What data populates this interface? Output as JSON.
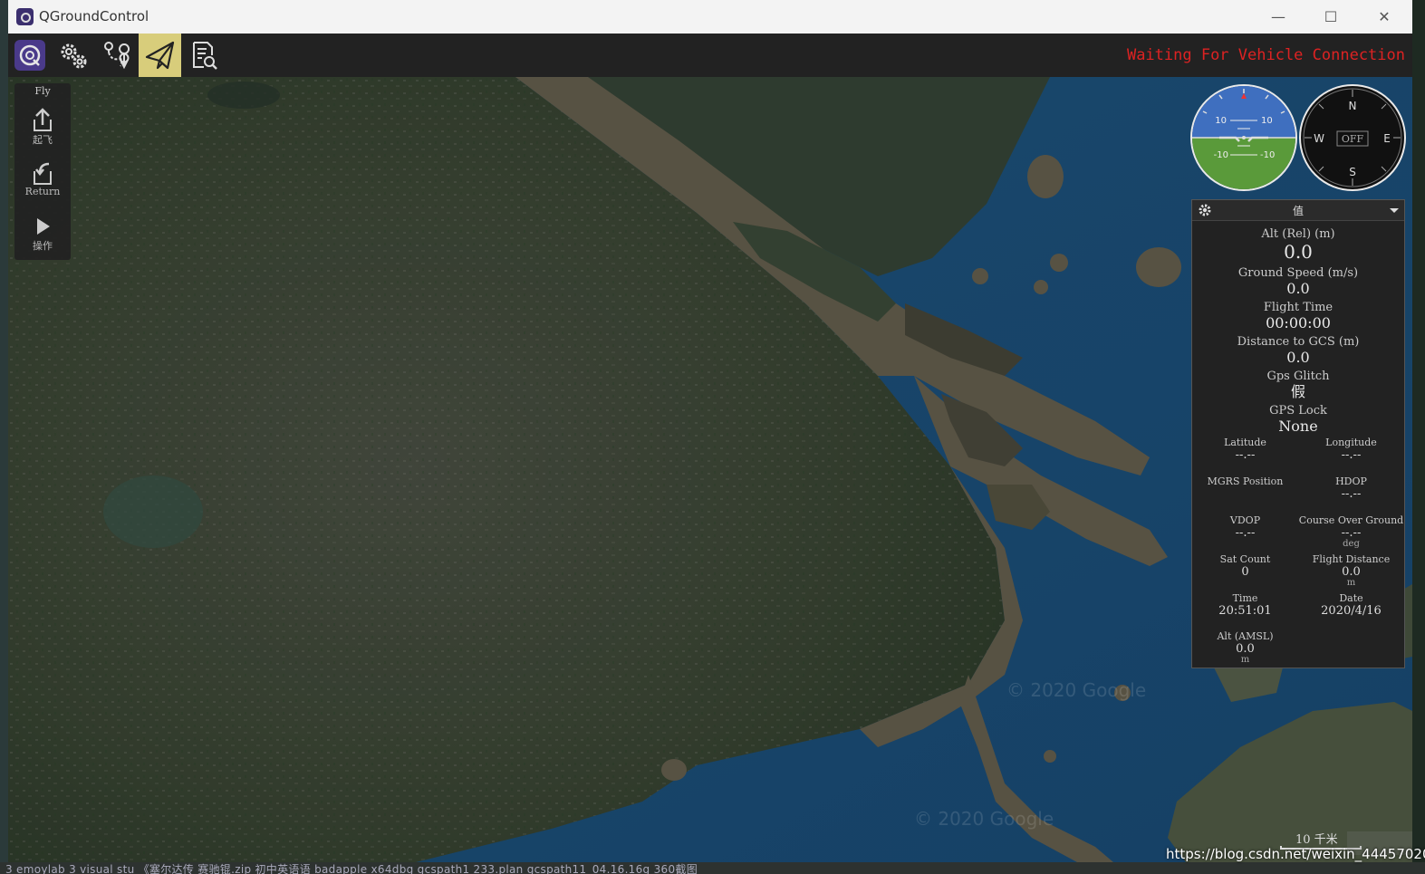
{
  "window": {
    "title": "QGroundControl",
    "controls": {
      "minimize": "—",
      "maximize": "☐",
      "close": "✕"
    }
  },
  "toolbar": {
    "buttons": [
      {
        "id": "logo",
        "icon": "qgc-logo-icon"
      },
      {
        "id": "settings",
        "icon": "gears-icon"
      },
      {
        "id": "plan",
        "icon": "plan-route-icon"
      },
      {
        "id": "fly",
        "icon": "paper-plane-icon",
        "active": true
      },
      {
        "id": "analyze",
        "icon": "analyze-document-icon"
      }
    ],
    "status": "Waiting For Vehicle Connection",
    "status_color": "#d22222",
    "active_color": "#d8cd7b"
  },
  "toolstrip": {
    "title": "Fly",
    "items": [
      {
        "label": "起飞",
        "icon": "takeoff-icon"
      },
      {
        "label": "Return",
        "icon": "return-icon"
      },
      {
        "label": "操作",
        "icon": "play-icon"
      }
    ]
  },
  "attitude": {
    "upper_left": "10",
    "upper_right": "10",
    "lower_left": "-10",
    "lower_right": "-10",
    "sky_color": "#3f6fbf",
    "ground_color": "#5a9a3a"
  },
  "compass": {
    "n": "N",
    "e": "E",
    "s": "S",
    "w": "W",
    "heading_box": "OFF"
  },
  "values": {
    "header": "值",
    "alt_rel": {
      "label": "Alt (Rel) (m)",
      "value": "0.0"
    },
    "ground_speed": {
      "label": "Ground Speed (m/s)",
      "value": "0.0"
    },
    "flight_time": {
      "label": "Flight Time",
      "value": "00:00:00"
    },
    "distance_gcs": {
      "label": "Distance to GCS (m)",
      "value": "0.0"
    },
    "gps_glitch": {
      "label": "Gps Glitch",
      "value": "假"
    },
    "gps_lock": {
      "label": "GPS Lock",
      "value": "None"
    },
    "latitude": {
      "label": "Latitude",
      "value": "--.--"
    },
    "longitude": {
      "label": "Longitude",
      "value": "--.--"
    },
    "mgrs": {
      "label": "MGRS Position",
      "value": ""
    },
    "hdop": {
      "label": "HDOP",
      "value": "--.--"
    },
    "vdop": {
      "label": "VDOP",
      "value": "--.--"
    },
    "course": {
      "label": "Course Over Ground",
      "value": "--.--",
      "unit": "deg"
    },
    "sat_count": {
      "label": "Sat Count",
      "value": "0"
    },
    "flight_distance": {
      "label": "Flight Distance",
      "value": "0.0",
      "unit": "m"
    },
    "time": {
      "label": "Time",
      "value": "20:51:01"
    },
    "date": {
      "label": "Date",
      "value": "2020/4/16"
    },
    "alt_amsl": {
      "label": "Alt (AMSL)",
      "value": "0.0",
      "unit": "m"
    }
  },
  "map": {
    "scale": "10 千米",
    "copyright": "© 2020 Google",
    "watermark": "https://blog.csdn.net/weixin_44457020"
  },
  "taskbar": {
    "text": "3 emoylab 3 visual stu 《塞尔达传 赛驰锟.zip 初中英语语 badapple x64dbg gcspath1 233.plan gcspath11_04.16.16g 360截图"
  }
}
